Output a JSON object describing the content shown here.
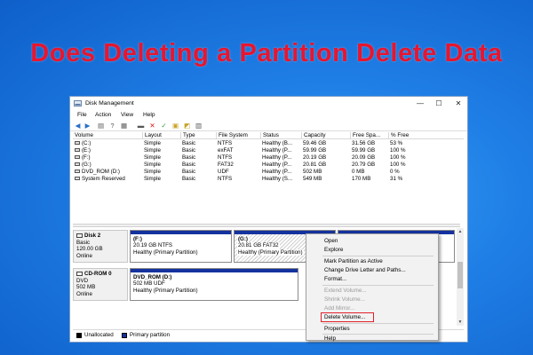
{
  "headline": "Does Deleting a Partition Delete Data",
  "window": {
    "title": "Disk Management",
    "controls": {
      "minimize": "—",
      "maximize": "☐",
      "close": "✕"
    }
  },
  "menubar": [
    "File",
    "Action",
    "View",
    "Help"
  ],
  "toolbar_icons": [
    "back-icon",
    "forward-icon",
    "view-icon",
    "help-icon",
    "properties-icon",
    "delete-icon",
    "check-icon",
    "open-icon",
    "explore-icon",
    "refresh-icon"
  ],
  "volume_table": {
    "headers": [
      "Volume",
      "Layout",
      "Type",
      "File System",
      "Status",
      "Capacity",
      "Free Spa...",
      "% Free"
    ],
    "rows": [
      [
        "(C:)",
        "Simple",
        "Basic",
        "NTFS",
        "Healthy (B...",
        "59.46 GB",
        "31.56 GB",
        "53 %"
      ],
      [
        "(E:)",
        "Simple",
        "Basic",
        "exFAT",
        "Healthy (P...",
        "59.99 GB",
        "59.99 GB",
        "100 %"
      ],
      [
        "(F:)",
        "Simple",
        "Basic",
        "NTFS",
        "Healthy (P...",
        "20.19 GB",
        "20.09 GB",
        "100 %"
      ],
      [
        "(G:)",
        "Simple",
        "Basic",
        "FAT32",
        "Healthy (P...",
        "20.81 GB",
        "20.79 GB",
        "100 %"
      ],
      [
        "DVD_ROM (D:)",
        "Simple",
        "Basic",
        "UDF",
        "Healthy (P...",
        "502 MB",
        "0 MB",
        "0 %"
      ],
      [
        "System Reserved",
        "Simple",
        "Basic",
        "NTFS",
        "Healthy (S...",
        "549 MB",
        "170 MB",
        "31 %"
      ]
    ]
  },
  "disks": [
    {
      "name": "Disk 2",
      "type": "Basic",
      "size": "120.00 GB",
      "status": "Online",
      "partitions": [
        {
          "label": "(F:)",
          "detail": "20.19 GB NTFS",
          "status": "Healthy (Primary Partition)",
          "selected": false
        },
        {
          "label": "(G:)",
          "detail": "20.81 GB FAT32",
          "status": "Healthy (Primary Partition)",
          "selected": true
        }
      ]
    },
    {
      "name": "CD-ROM 0",
      "type": "DVD",
      "size": "502 MB",
      "status": "Online",
      "partitions": [
        {
          "label": "DVD_ROM  (D:)",
          "detail": "502 MB UDF",
          "status": "Healthy (Primary Partition)",
          "selected": false
        }
      ]
    }
  ],
  "legend": [
    {
      "label": "Unallocated",
      "color": "#000000"
    },
    {
      "label": "Primary partition",
      "color": "#14329e"
    }
  ],
  "context_menu": {
    "items": [
      {
        "label": "Open",
        "enabled": true
      },
      {
        "label": "Explore",
        "enabled": true
      },
      {
        "label": "Mark Partition as Active",
        "enabled": true
      },
      {
        "label": "Change Drive Letter and Paths...",
        "enabled": true
      },
      {
        "label": "Format...",
        "enabled": true
      },
      {
        "label": "Extend Volume...",
        "enabled": false
      },
      {
        "label": "Shrink Volume...",
        "enabled": false
      },
      {
        "label": "Add Mirror...",
        "enabled": false
      },
      {
        "label": "Delete Volume...",
        "enabled": true,
        "highlighted": true
      },
      {
        "label": "Properties",
        "enabled": true
      },
      {
        "label": "Help",
        "enabled": true
      }
    ],
    "highlight_color": "#e0202a"
  },
  "colors": {
    "headline": "#e8152e",
    "background": "#1f7fe6",
    "primary_partition": "#14329e"
  }
}
